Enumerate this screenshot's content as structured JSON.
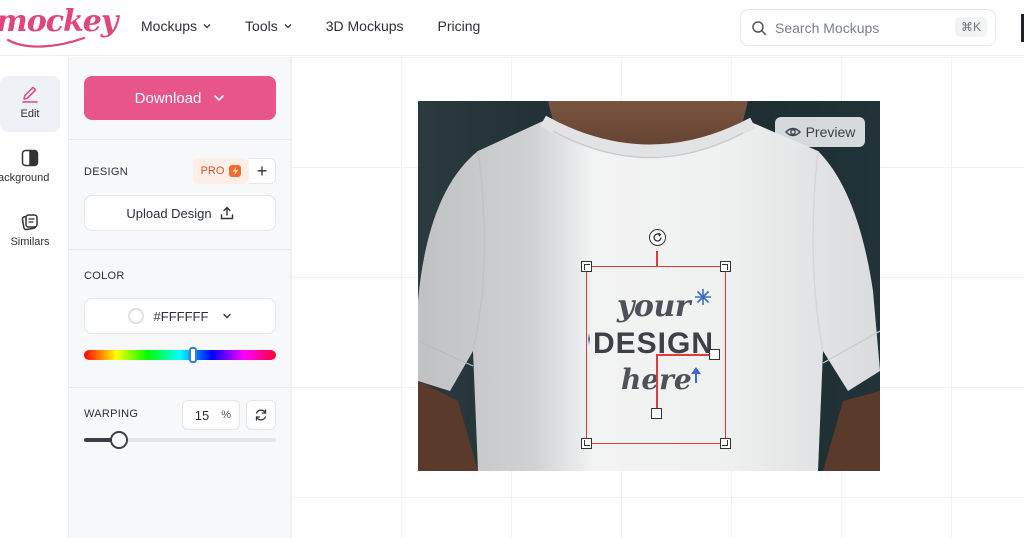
{
  "header": {
    "logo_text": "mockey",
    "nav": [
      {
        "label": "Mockups",
        "has_dropdown": true
      },
      {
        "label": "Tools",
        "has_dropdown": true
      },
      {
        "label": "3D Mockups",
        "has_dropdown": false
      },
      {
        "label": "Pricing",
        "has_dropdown": false
      }
    ],
    "search": {
      "placeholder": "Search Mockups",
      "shortcut": "⌘K"
    }
  },
  "rail": {
    "items": [
      {
        "label": "Edit",
        "icon": "pencil-icon",
        "active": true
      },
      {
        "label": "Background",
        "icon": "background-icon",
        "active": false
      },
      {
        "label": "Similars",
        "icon": "similars-icon",
        "active": false
      }
    ]
  },
  "panel": {
    "download_label": "Download",
    "design": {
      "label": "DESIGN",
      "pro_label": "PRO",
      "plus_label": "+",
      "upload_label": "Upload Design"
    },
    "color": {
      "label": "COLOR",
      "value": "#FFFFFF",
      "hue_position": 0.57
    },
    "warping": {
      "label": "WARPING",
      "value": "15",
      "unit": "%",
      "fraction": 0.18
    }
  },
  "canvas": {
    "preview_label": "Preview",
    "design_text": {
      "line1": "your",
      "line2": "DESIGN",
      "line3": "here"
    }
  },
  "colors": {
    "brand": "#e8558a",
    "frame": "#e13a3a",
    "shirt": "#e9eaeb"
  }
}
